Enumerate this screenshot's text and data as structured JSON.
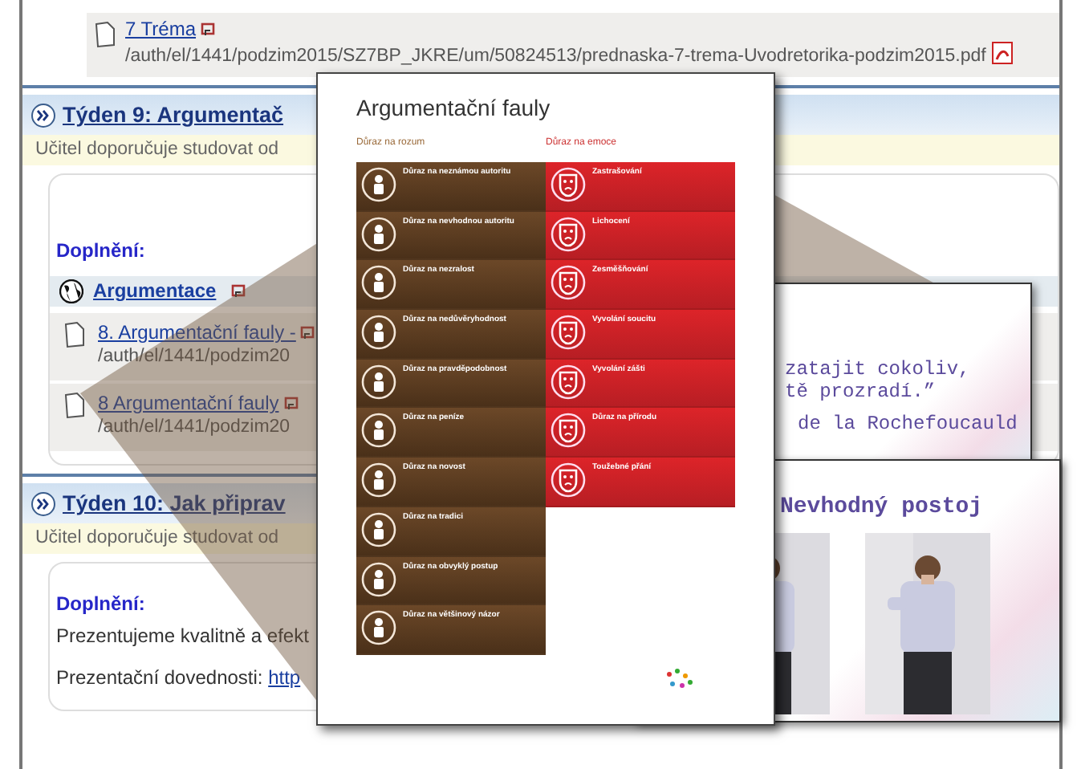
{
  "top_item": {
    "title": "7 Tréma",
    "path": "/auth/el/1441/podzim2015/SZ7BP_JKRE/um/50824513/prednaska-7-trema-Uvodretorika-podzim2015.pdf"
  },
  "weeks": [
    {
      "title": "Týden 9: Argumentač",
      "note": "Učitel doporučuje studovat od",
      "label": "Doplnění:",
      "items": [
        {
          "kind": "web",
          "title": "Argumentace"
        },
        {
          "kind": "file",
          "title": "8. Argumentační fauly -",
          "path": "/auth/el/1441/podzim20"
        },
        {
          "kind": "file",
          "title": "8 Argumentační fauly",
          "path": "/auth/el/1441/podzim20"
        }
      ]
    },
    {
      "title": "Týden 10: Jak připrav",
      "note": "Učitel doporučuje studovat od",
      "label": "Doplnění:",
      "lines": [
        {
          "text": "Prezentujeme kvalitně a efekt"
        },
        {
          "text": "Prezentační dovednosti:",
          "link": "http"
        }
      ]
    }
  ],
  "poster": {
    "title": "Argumentační fauly",
    "columns": [
      {
        "heading": "Důraz na rozum",
        "kind": "reason",
        "tiles": [
          "Důraz na neznámou autoritu",
          "Důraz na nevhodnou autoritu",
          "Důraz na nezralost",
          "Důraz na nedůvěryhodnost",
          "Důraz na pravděpodobnost",
          "Důraz na peníze",
          "Důraz na novost",
          "Důraz na tradici",
          "Důraz na obvyklý postup",
          "Důraz na většinový názor"
        ]
      },
      {
        "heading": "Důraz na emoce",
        "kind": "emotion",
        "tiles": [
          "Zastrašování",
          "Lichocení",
          "Zesměšňování",
          "Vyvolání soucitu",
          "Vyvolání zášti",
          "Důraz na přírodu",
          "Toužebné přání"
        ]
      }
    ]
  },
  "slides": [
    {
      "kind": "quote",
      "lines": [
        "zatajit cokoliv,",
        "tě prozradí.”"
      ],
      "author": "de la Rochefoucauld"
    },
    {
      "kind": "photos",
      "title": "Nevhodný postoj"
    }
  ]
}
